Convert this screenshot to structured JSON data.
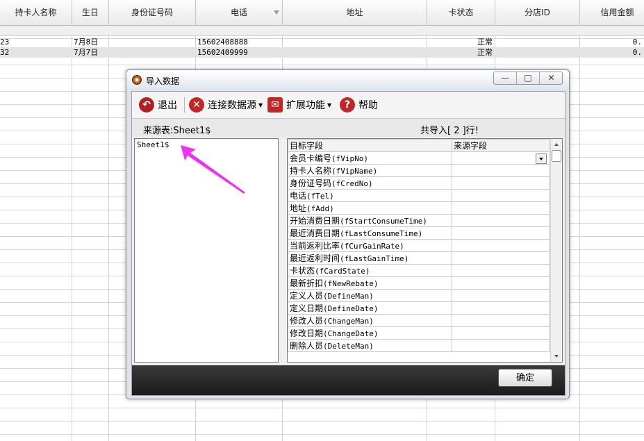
{
  "spreadsheet": {
    "headers": [
      "持卡人名称",
      "生日",
      "身份证号码",
      "电话",
      "地址",
      "卡状态",
      "分店ID",
      "信用金额"
    ],
    "rows": [
      {
        "name": "23",
        "birthday": "7月8日",
        "id_no": "",
        "phone": "15602408888",
        "address": "",
        "status": "正常",
        "branch": "",
        "credit": "0."
      },
      {
        "name": "32",
        "birthday": "7月7日",
        "id_no": "",
        "phone": "15602409999",
        "address": "",
        "status": "正常",
        "branch": "",
        "credit": "0."
      }
    ]
  },
  "dialog": {
    "title": "导入数据",
    "window_buttons": {
      "minimize": "—",
      "maximize": "□",
      "close": "✕"
    },
    "toolbar": {
      "exit_label": "退出",
      "connect_label": "连接数据源",
      "extend_label": "扩展功能",
      "help_label": "帮助"
    },
    "source_table_label": "来源表:Sheet1$",
    "import_count_label": "共导入[ 2 ]行!",
    "source_list": [
      "Sheet1$"
    ],
    "mapping": {
      "header_target": "目标字段",
      "header_source": "来源字段",
      "rows": [
        {
          "cn": "会员卡编号",
          "en": "(fVipNo)"
        },
        {
          "cn": "持卡人名称",
          "en": "(fVipName)"
        },
        {
          "cn": "身份证号码",
          "en": "(fCredNo)"
        },
        {
          "cn": "电话",
          "en": "(fTel)"
        },
        {
          "cn": "地址",
          "en": "(fAdd)"
        },
        {
          "cn": "开始消费日期",
          "en": "(fStartConsumeTime)"
        },
        {
          "cn": "最近消费日期",
          "en": "(fLastConsumeTime)"
        },
        {
          "cn": "当前返利比率",
          "en": "(fCurGainRate)"
        },
        {
          "cn": "最近返利时间",
          "en": "(fLastGainTime)"
        },
        {
          "cn": "卡状态",
          "en": "(fCardState)"
        },
        {
          "cn": "最新折扣",
          "en": "(fNewRebate)"
        },
        {
          "cn": "定义人员",
          "en": "(DefineMan)"
        },
        {
          "cn": "定义日期",
          "en": "(DefineDate)"
        },
        {
          "cn": "修改人员",
          "en": "(ChangeMan)"
        },
        {
          "cn": "修改日期",
          "en": "(ChangeDate)"
        },
        {
          "cn": "删除人员",
          "en": "(DeleteMan)"
        }
      ]
    },
    "ok_label": "确定",
    "colors": {
      "exit_icon": "#b02020",
      "connect_icon": "#c02828",
      "extend_icon": "#c02828",
      "help_icon": "#c02828",
      "arrow": "#ee33ee"
    }
  }
}
